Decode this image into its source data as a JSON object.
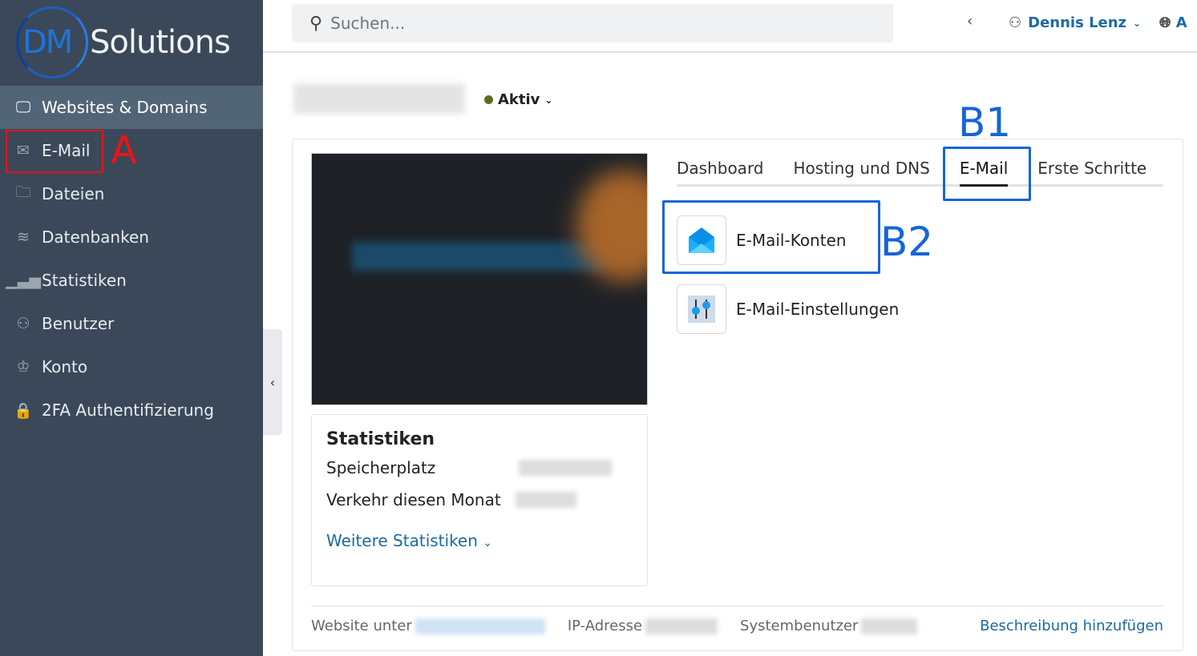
{
  "logo": {
    "brand_a": "DM",
    "brand_b": "Solutions"
  },
  "sidebar": {
    "items": [
      {
        "label": "Websites & Domains",
        "icon": "monitor-icon"
      },
      {
        "label": "E-Mail",
        "icon": "envelope-open-icon"
      },
      {
        "label": "Dateien",
        "icon": "folder-icon"
      },
      {
        "label": "Datenbanken",
        "icon": "database-layers-icon"
      },
      {
        "label": "Statistiken",
        "icon": "bar-chart-icon"
      },
      {
        "label": "Benutzer",
        "icon": "user-icon"
      },
      {
        "label": "Konto",
        "icon": "crown-icon"
      },
      {
        "label": "2FA Authentifizierung",
        "icon": "2fa-lock-icon"
      }
    ]
  },
  "annotations": {
    "a": "A",
    "b1": "B1",
    "b2": "B2",
    "colors": {
      "a": "#e8141a",
      "b": "#1565d8"
    }
  },
  "topbar": {
    "search_placeholder": "Suchen...",
    "user": "Dennis Lenz",
    "lang": "A"
  },
  "site": {
    "status": "Aktiv"
  },
  "tabs": [
    "Dashboard",
    "Hosting und DNS",
    "E-Mail",
    "Erste Schritte"
  ],
  "tools": [
    {
      "label": "E-Mail-Konten",
      "icon": "envelope-icon"
    },
    {
      "label": "E-Mail-Einstellungen",
      "icon": "sliders-icon"
    }
  ],
  "stats": {
    "title": "Statistiken",
    "rows": [
      "Speicherplatz",
      "Verkehr diesen Monat"
    ],
    "more": "Weitere Statistiken"
  },
  "footer": {
    "website": "Website unter",
    "ip": "IP-Adresse",
    "sysuser": "Systembenutzer",
    "add_desc": "Beschreibung hinzufügen"
  }
}
